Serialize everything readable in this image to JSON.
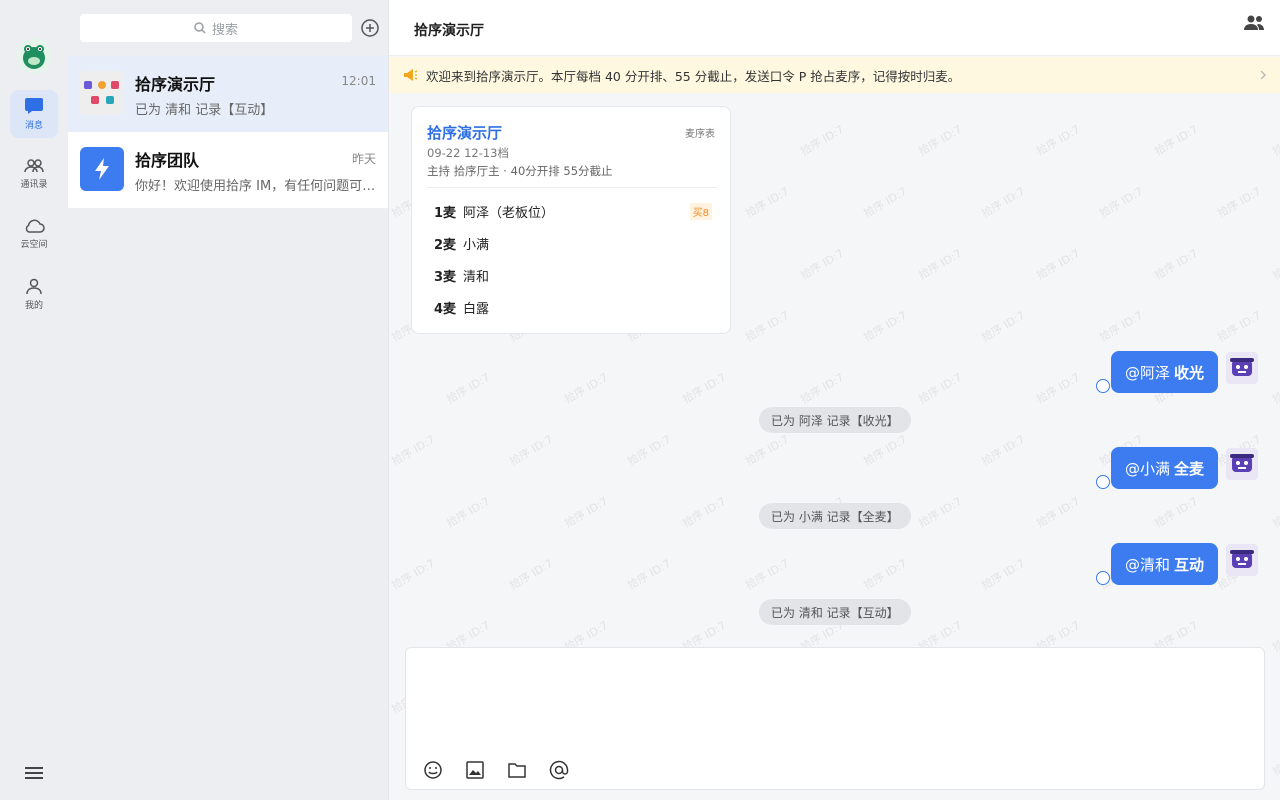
{
  "rail": {
    "items": [
      {
        "label": "消息",
        "icon": "message-icon"
      },
      {
        "label": "通讯录",
        "icon": "contacts-icon"
      },
      {
        "label": "云空间",
        "icon": "cloud-icon"
      },
      {
        "label": "我的",
        "icon": "profile-icon"
      }
    ]
  },
  "search": {
    "placeholder": "搜索"
  },
  "conversations": [
    {
      "name": "拾序演示厅",
      "time": "12:01",
      "preview": "已为 清和 记录【互动】"
    },
    {
      "name": "拾序团队",
      "time": "昨天",
      "preview": "你好！欢迎使用拾序 IM，有任何问题可以随时联系我们。"
    }
  ],
  "header": {
    "title": "拾序演示厅"
  },
  "notice": {
    "text": "欢迎来到拾序演示厅。本厅每档 40 分开排、55 分截止，发送口令 P 抢占麦序，记得按时归麦。"
  },
  "watermark": "拾序 ID:7",
  "mic_card": {
    "title": "拾序演示厅",
    "tag": "麦序表",
    "slot": "09-22 12-13档",
    "host": "主持 拾序厅主 · 40分开排 55分截止",
    "rows": [
      {
        "num": "1麦",
        "name": "阿泽（老板位）",
        "badge": "买8"
      },
      {
        "num": "2麦",
        "name": "小满",
        "badge": ""
      },
      {
        "num": "3麦",
        "name": "清和",
        "badge": ""
      },
      {
        "num": "4麦",
        "name": "白露",
        "badge": ""
      }
    ]
  },
  "messages": [
    {
      "mention": "@阿泽",
      "command": "收光",
      "system": "已为 阿泽 记录【收光】"
    },
    {
      "mention": "@小满",
      "command": "全麦",
      "system": "已为 小满 记录【全麦】"
    },
    {
      "mention": "@清和",
      "command": "互动",
      "system": "已为 清和 记录【互动】"
    }
  ],
  "input": {
    "value": ""
  },
  "colors": {
    "accent": "#3c7cf0",
    "notice_bg": "#fff8e1",
    "brand_green": "#1f8f5f"
  }
}
